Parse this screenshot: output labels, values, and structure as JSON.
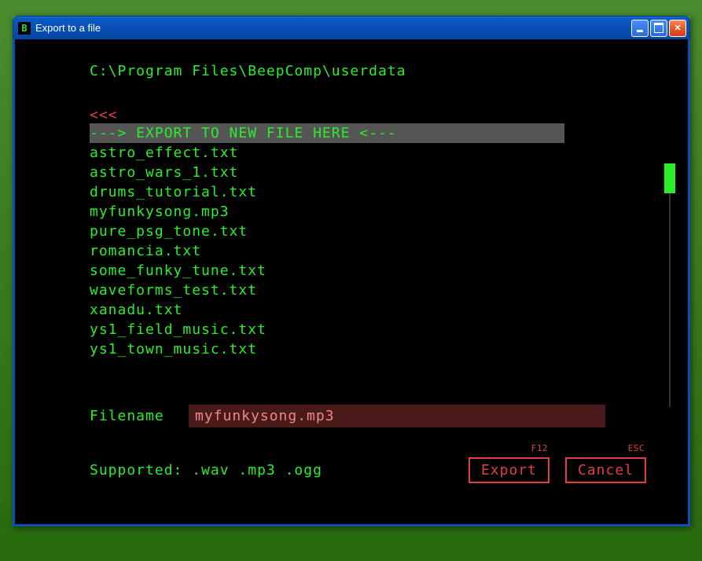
{
  "window": {
    "title": "Export to a file",
    "icon_letter": "B"
  },
  "path": "C:\\Program Files\\BeepComp\\userdata",
  "back_nav": "<<<",
  "export_new_line": "---> EXPORT TO NEW FILE HERE <---",
  "files": [
    "astro_effect.txt",
    "astro_wars_1.txt",
    "drums_tutorial.txt",
    "myfunkysong.mp3",
    "pure_psg_tone.txt",
    "romancia.txt",
    "some_funky_tune.txt",
    "waveforms_test.txt",
    "xanadu.txt",
    "ys1_field_music.txt",
    "ys1_town_music.txt"
  ],
  "filename": {
    "label": "Filename",
    "value": "myfunkysong.mp3"
  },
  "supported": "Supported: .wav .mp3 .ogg",
  "buttons": {
    "export": {
      "label": "Export",
      "shortcut": "F12"
    },
    "cancel": {
      "label": "Cancel",
      "shortcut": "ESC"
    }
  }
}
